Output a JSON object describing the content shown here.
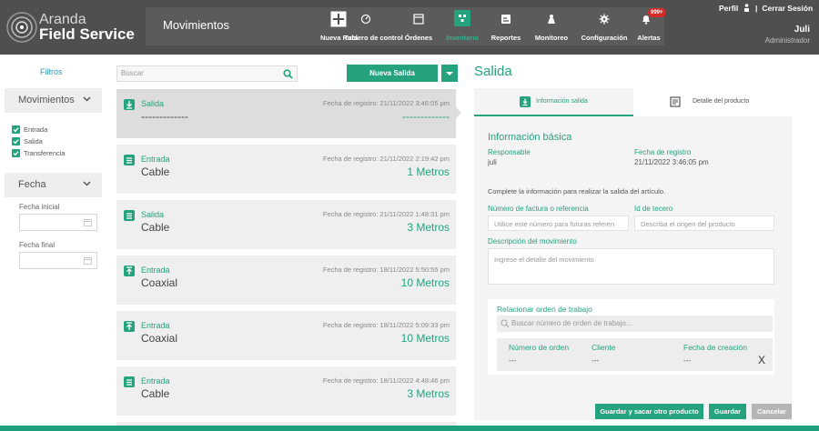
{
  "header": {
    "brand_line1": "Aranda",
    "brand_line2": "Field Service",
    "page_title": "Movimientos",
    "nav": [
      {
        "label": "Nueva Ruta",
        "icon": "plus-icon"
      },
      {
        "label": "Tablero de control",
        "icon": "dashboard-icon"
      },
      {
        "label": "Órdenes",
        "icon": "orders-icon"
      },
      {
        "label": "Inventario",
        "icon": "inventory-icon",
        "active": true
      },
      {
        "label": "Reportes",
        "icon": "reports-icon"
      },
      {
        "label": "Monitoreo",
        "icon": "monitor-icon"
      },
      {
        "label": "Configuración",
        "icon": "gear-icon"
      },
      {
        "label": "Alertas",
        "icon": "bell-icon",
        "badge": "999+"
      }
    ],
    "profile": "Perfil",
    "logout": "Cerrar Sesión",
    "user_name": "Juli",
    "user_role": "Administrador"
  },
  "filters": {
    "title": "Filtros",
    "movements_label": "Movimientos",
    "options": [
      "Entrada",
      "Salida",
      "Transferencia"
    ],
    "date_label": "Fecha",
    "start_label": "Fecha inicial",
    "end_label": "Fecha final"
  },
  "list": {
    "search_placeholder": "Buscar",
    "new_button": "Nueva Salida",
    "items": [
      {
        "type": "Salida",
        "name": "-------------",
        "date": "Fecha de registro: 21/11/2022 3:46:05 pm",
        "qty": "-------------"
      },
      {
        "type": "Entrada",
        "name": "Cable",
        "date": "Fecha de registro: 21/11/2022 2:19:42 pm",
        "qty": "1 Metros"
      },
      {
        "type": "Salida",
        "name": "Cable",
        "date": "Fecha de registro: 21/11/2022 1:48:31 pm",
        "qty": "3 Metros"
      },
      {
        "type": "Entrada",
        "name": "Coaxial",
        "date": "Fecha de registro: 18/11/2022 5:50:55 pm",
        "qty": "10 Metros"
      },
      {
        "type": "Entrada",
        "name": "Coaxial",
        "date": "Fecha de registro: 18/11/2022 5:09:33 pm",
        "qty": "10 Metros"
      },
      {
        "type": "Entrada",
        "name": "Cable",
        "date": "Fecha de registro: 18/11/2022 4:48:46 pm",
        "qty": "3 Metros"
      }
    ]
  },
  "detail": {
    "title": "Salida",
    "tab_info": "Información salida",
    "tab_product": "Detalle del producto",
    "section_title": "Información básica",
    "responsible_label": "Responsable",
    "responsible_value": "juli",
    "reg_date_label": "Fecha de registro",
    "reg_date_value": "21/11/2022 3:46:05 pm",
    "instruction": "Complete la información para realizar la salida del artículo.",
    "invoice_label": "Número de factura o referencia",
    "invoice_placeholder": "Utilice este número para futuras referen",
    "third_label": "Id de tecero",
    "third_placeholder": "Describa el origen del producto",
    "desc_label": "Descripción del movimiento",
    "desc_placeholder": "Ingrese el detalle del movimiento",
    "ot_title": "Relacionar orden de trabajo",
    "ot_search_placeholder": "Buscar número de orden de trabajo...",
    "ot_col_number": "Número de orden",
    "ot_col_client": "Cliente",
    "ot_col_date": "Fecha de creación",
    "ot_val_number": "---",
    "ot_val_client": "---",
    "ot_val_date": "---",
    "ot_close": "X",
    "btn_save_another": "Guardar y sacar otro producto",
    "btn_save": "Guardar",
    "btn_cancel": "Cancelar"
  },
  "colors": {
    "accent": "#24a37e",
    "header": "#4f4f4f",
    "link": "#2a9bb8",
    "badge": "#d42a2a"
  }
}
